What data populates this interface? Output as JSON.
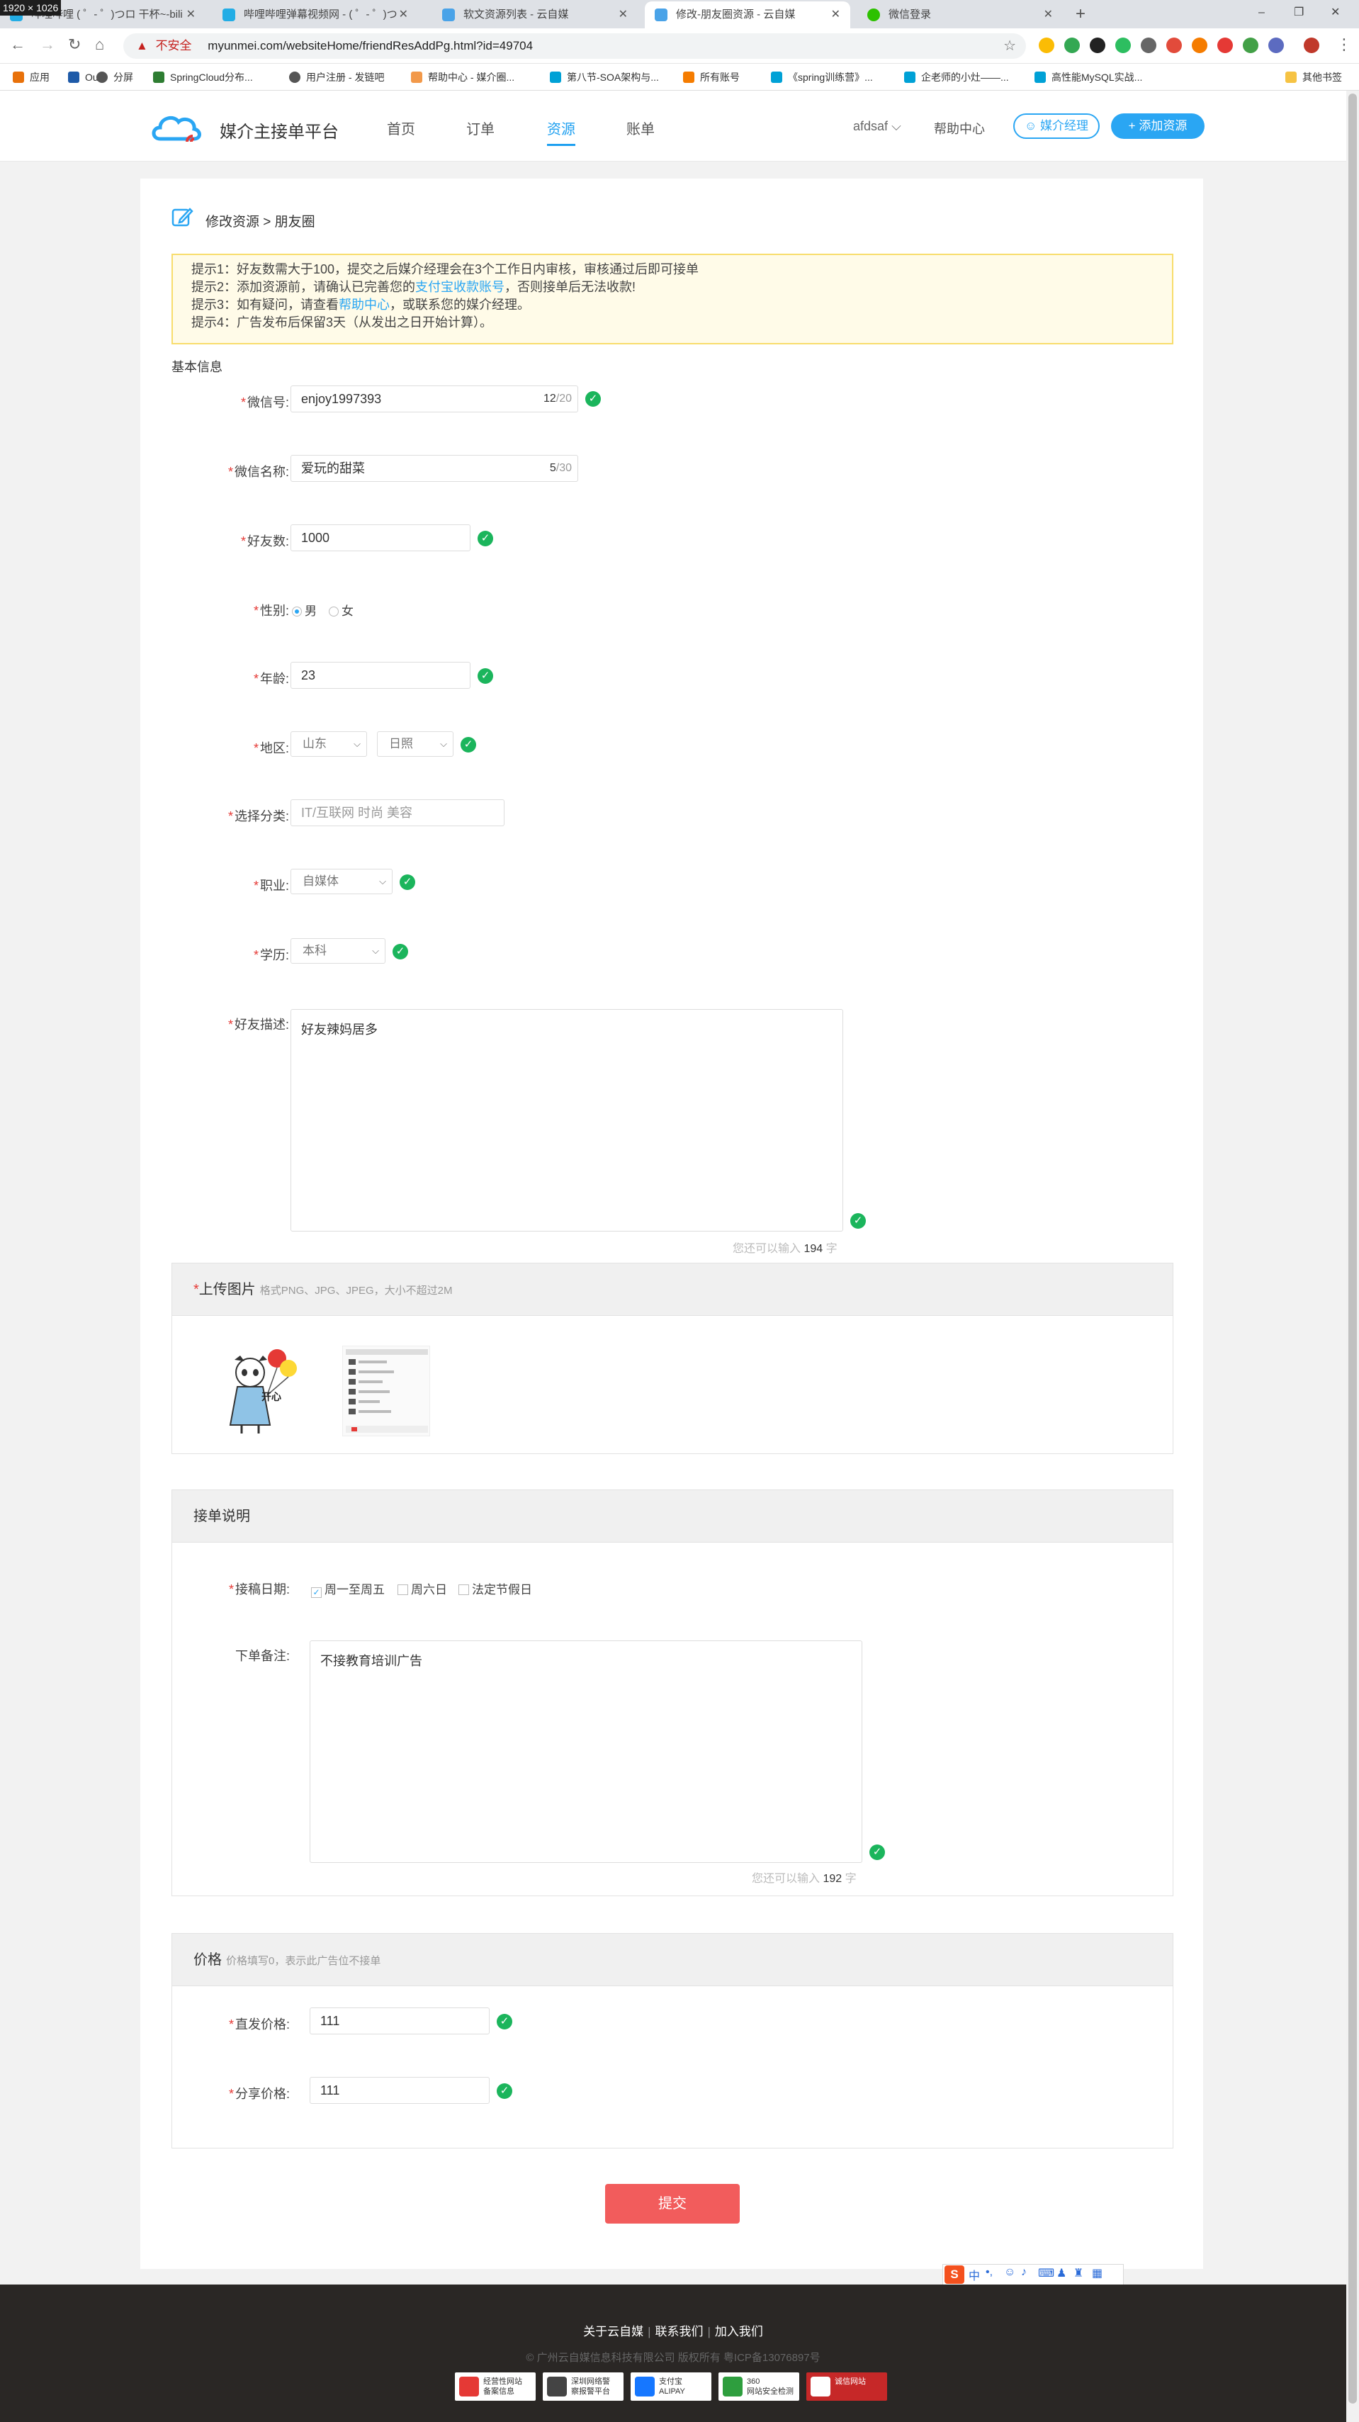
{
  "screenshot_size": "1920 × 1026",
  "browser": {
    "tabs": [
      {
        "title": "哔哩哔哩 ( ゜- ゜)つロ 干杯~-bili",
        "active": false
      },
      {
        "title": "哔哩哔哩弹幕视频网 - ( ゜- ゜)つ",
        "active": false
      },
      {
        "title": "软文资源列表 - 云自媒",
        "active": false
      },
      {
        "title": "修改-朋友圈资源 - 云自媒",
        "active": true
      },
      {
        "title": "微信登录",
        "active": false
      }
    ],
    "security_label": "不安全",
    "url": "myunmei.com/websiteHome/friendResAddPg.html?id=49704",
    "bookmarks": [
      "应用",
      "Ou",
      "分屏",
      "SpringCloud分布...",
      "用户注册 - 发链吧",
      "帮助中心 - 媒介圈...",
      "第八节-SOA架构与...",
      "所有账号",
      "《spring训练营》...",
      "企老师的小灶——...",
      "高性能MySQL实战...",
      "其他书签"
    ]
  },
  "site": {
    "logo_text": "媒介主接单平台",
    "nav": [
      "首页",
      "订单",
      "资源",
      "账单"
    ],
    "active_nav": "资源",
    "user": "afdsaf",
    "help": "帮助中心",
    "manager_button": "媒介经理",
    "add_button": "+ 添加资源"
  },
  "page": {
    "breadcrumb": "修改资源 > 朋友圈",
    "tips": [
      "提示1：好友数需大于100，提交之后媒介经理会在3个工作日内审核，审核通过后即可接单",
      "提示2：添加资源前，请确认已完善您的",
      "支付宝收款账号",
      "，否则接单后无法收款!",
      "提示3：如有疑问，请查看",
      "帮助中心",
      "，或联系您的媒介经理。",
      "提示4：广告发布后保留3天（从发出之日开始计算）。"
    ],
    "section_basic": "基本信息"
  },
  "form": {
    "wechat_id": {
      "label": "微信号:",
      "value": "enjoy1997393",
      "count": "12",
      "max": "/20"
    },
    "wechat_name": {
      "label": "微信名称:",
      "value": "爱玩的甜菜",
      "count": "5",
      "max": "/30"
    },
    "friends": {
      "label": "好友数:",
      "value": "1000"
    },
    "gender": {
      "label": "性别:",
      "options": [
        "男",
        "女"
      ],
      "selected": "男"
    },
    "age": {
      "label": "年龄:",
      "value": "23"
    },
    "region": {
      "label": "地区:",
      "province": "山东",
      "city": "日照"
    },
    "category": {
      "label": "选择分类:",
      "placeholder": "IT/互联网 时尚 美容"
    },
    "occupation": {
      "label": "职业:",
      "value": "自媒体"
    },
    "education": {
      "label": "学历:",
      "value": "本科"
    },
    "description": {
      "label": "好友描述:",
      "value": "好友辣妈居多",
      "remain_prefix": "您还可以输入",
      "remain": "194",
      "remain_suffix": "字"
    }
  },
  "upload": {
    "title": "上传图片",
    "hint": "格式PNG、JPG、JPEG，大小不超过2M",
    "thumb1_text": "开心"
  },
  "order_section": {
    "title": "接单说明",
    "date_label": "接稿日期:",
    "options": [
      "周一至周五",
      "周六日",
      "法定节假日"
    ],
    "checked": [
      "周一至周五"
    ],
    "remark_label": "下单备注:",
    "remark": "不接教育培训广告",
    "remain_prefix": "您还可以输入",
    "remain": "192",
    "remain_suffix": "字"
  },
  "price_section": {
    "title": "价格",
    "hint": "价格填写0，表示此广告位不接单",
    "direct_label": "直发价格:",
    "direct_value": "111",
    "share_label": "分享价格:",
    "share_value": "111"
  },
  "submit": "提交",
  "footer": {
    "links": [
      "关于云自媒",
      "联系我们",
      "加入我们"
    ],
    "copyright": "© 广州云自媒信息科技有限公司 版权所有 粤ICP备13076897号",
    "badges": [
      {
        "line1": "经营性网站",
        "line2": "备案信息"
      },
      {
        "line1": "深圳网络警",
        "line2": "察报警平台"
      },
      {
        "line1": "支付宝",
        "line2": "ALIPAY"
      },
      {
        "line1": "360",
        "line2": "网站安全检测"
      },
      {
        "line1": "诚信网站",
        "line2": ""
      }
    ]
  },
  "colors": {
    "accent": "#2aa6f3",
    "submit": "#f25c5c",
    "ok": "#1bb55c",
    "required": "#e53935",
    "footer": "#2a2725"
  }
}
